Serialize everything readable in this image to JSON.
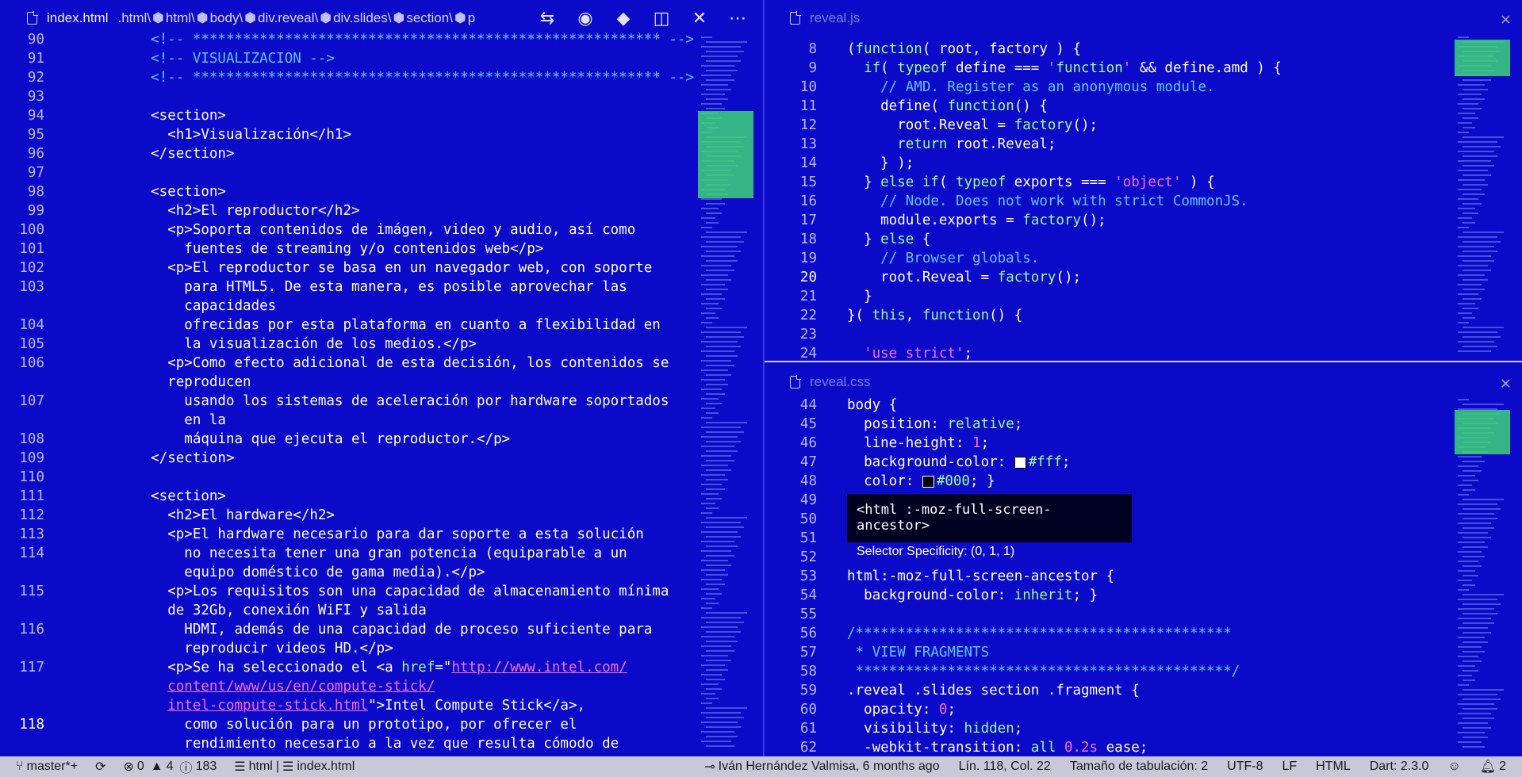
{
  "left_pane": {
    "tab_title": "index.html",
    "breadcrumbs": [
      ".html\\",
      "html\\",
      "body\\",
      "div.reveal\\",
      "div.slides\\",
      "section\\",
      "p"
    ],
    "actions": [
      "compare-changes-icon",
      "preview-icon",
      "git-icon",
      "split-editor-icon",
      "close-icon",
      "more-icon"
    ],
    "lines": [
      {
        "n": "90",
        "text": "    <!-- ******************************************************** -->"
      },
      {
        "n": "91",
        "text": "    <!-- VISUALIZACION -->"
      },
      {
        "n": "92",
        "text": "    <!-- ******************************************************** -->"
      },
      {
        "n": "93",
        "text": ""
      },
      {
        "n": "94",
        "text": "    <section>"
      },
      {
        "n": "95",
        "text": "      <h1>Visualización</h1>"
      },
      {
        "n": "96",
        "text": "    </section>"
      },
      {
        "n": "97",
        "text": ""
      },
      {
        "n": "98",
        "text": "    <section>"
      },
      {
        "n": "99",
        "text": "      <h2>El reproductor</h2>"
      },
      {
        "n": "100",
        "text": "      <p>Soporta contenidos de imágen, video y audio, así como"
      },
      {
        "n": "101",
        "text": "        fuentes de streaming y/o contenidos web</p>"
      },
      {
        "n": "102",
        "text": "      <p>El reproductor se basa en un navegador web, con soporte"
      },
      {
        "n": "103",
        "text": "        para HTML5. De esta manera, es posible aprovechar las"
      },
      {
        "n": "",
        "text": "        capacidades"
      },
      {
        "n": "104",
        "text": "        ofrecidas por esta plataforma en cuanto a flexibilidad en"
      },
      {
        "n": "105",
        "text": "        la visualización de los medios.</p>"
      },
      {
        "n": "106",
        "text": "      <p>Como efecto adicional de esta decisión, los contenidos se"
      },
      {
        "n": "",
        "text": "      reproducen"
      },
      {
        "n": "107",
        "text": "        usando los sistemas de aceleración por hardware soportados"
      },
      {
        "n": "",
        "text": "        en la"
      },
      {
        "n": "108",
        "text": "        máquina que ejecuta el reproductor.</p>"
      },
      {
        "n": "109",
        "text": "    </section>"
      },
      {
        "n": "110",
        "text": ""
      },
      {
        "n": "111",
        "text": "    <section>"
      },
      {
        "n": "112",
        "text": "      <h2>El hardware</h2>"
      },
      {
        "n": "113",
        "text": "      <p>El hardware necesario para dar soporte a esta solución"
      },
      {
        "n": "114",
        "text": "        no necesita tener una gran potencia (equiparable a un"
      },
      {
        "n": "",
        "text": "        equipo doméstico de gama media).</p>"
      },
      {
        "n": "115",
        "text": "      <p>Los requisitos son una capacidad de almacenamiento mínima"
      },
      {
        "n": "",
        "text": "      de 32Gb, conexión WiFI y salida"
      },
      {
        "n": "116",
        "text": "        HDMI, además de una capacidad de proceso suficiente para"
      },
      {
        "n": "",
        "text": "        reproducir videos HD.</p>"
      },
      {
        "n": "117",
        "text": "      <p>Se ha seleccionado el <a href=\"http://www.intel.com/"
      },
      {
        "n": "",
        "text": "      content/www/us/en/compute-stick/"
      },
      {
        "n": "",
        "text": "      intel-compute-stick.html\">Intel Compute Stick</a>,"
      },
      {
        "n": "118",
        "text": "        como solución para un prototipo, por ofrecer el"
      },
      {
        "n": "",
        "text": "        rendimiento necesario a la vez que resulta cómodo de"
      }
    ]
  },
  "right_top_pane": {
    "tab_title": "reveal.js",
    "lines": [
      {
        "n": "8",
        "text": "(function( root, factory ) {"
      },
      {
        "n": "9",
        "text": "  if( typeof define === 'function' && define.amd ) {"
      },
      {
        "n": "10",
        "text": "    // AMD. Register as an anonymous module."
      },
      {
        "n": "11",
        "text": "    define( function() {"
      },
      {
        "n": "12",
        "text": "      root.Reveal = factory();"
      },
      {
        "n": "13",
        "text": "      return root.Reveal;"
      },
      {
        "n": "14",
        "text": "    } );"
      },
      {
        "n": "15",
        "text": "  } else if( typeof exports === 'object' ) {"
      },
      {
        "n": "16",
        "text": "    // Node. Does not work with strict CommonJS."
      },
      {
        "n": "17",
        "text": "    module.exports = factory();"
      },
      {
        "n": "18",
        "text": "  } else {"
      },
      {
        "n": "19",
        "text": "    // Browser globals."
      },
      {
        "n": "20",
        "text": "    root.Reveal = factory();"
      },
      {
        "n": "21",
        "text": "  }"
      },
      {
        "n": "22",
        "text": "}( this, function() {"
      },
      {
        "n": "23",
        "text": ""
      },
      {
        "n": "24",
        "text": "  'use strict';"
      }
    ]
  },
  "right_bottom_pane": {
    "tab_title": "reveal.css",
    "lines": [
      {
        "n": "44",
        "text": "body {"
      },
      {
        "n": "45",
        "text": "  position: relative;"
      },
      {
        "n": "46",
        "text": "  line-height: 1;"
      },
      {
        "n": "47",
        "text": "  background-color: #fff;"
      },
      {
        "n": "48",
        "text": "  color: #000; }"
      },
      {
        "n": "49",
        "text": ""
      },
      {
        "n": "50",
        "text": ""
      },
      {
        "n": "51",
        "text": ""
      },
      {
        "n": "52",
        "text": ""
      },
      {
        "n": "53",
        "text": "html:-moz-full-screen-ancestor {"
      },
      {
        "n": "54",
        "text": "  background-color: inherit; }"
      },
      {
        "n": "55",
        "text": ""
      },
      {
        "n": "56",
        "text": "/*********************************************"
      },
      {
        "n": "57",
        "text": " * VIEW FRAGMENTS"
      },
      {
        "n": "58",
        "text": " *********************************************/"
      },
      {
        "n": "59",
        "text": ".reveal .slides section .fragment {"
      },
      {
        "n": "60",
        "text": "  opacity: 0;"
      },
      {
        "n": "61",
        "text": "  visibility: hidden;"
      },
      {
        "n": "62",
        "text": "  -webkit-transition: all 0.2s ease;"
      }
    ],
    "hover": {
      "selector": "<html :-moz-full-screen-ancestor>",
      "specificity": "Selector Specificity: (0, 1, 1)"
    }
  },
  "status_bar": {
    "branch": "master*+",
    "errors": "0",
    "warnings": "4",
    "info": "183",
    "language_mode": "html",
    "file": "index.html",
    "blame": "Iván Hernández Valmisa, 6 months ago",
    "position": "Lín. 118, Col. 22",
    "tab_size": "Tamaño de tabulación: 2",
    "encoding": "UTF-8",
    "eol": "LF",
    "language": "HTML",
    "dart": "Dart: 2.3.0",
    "notifications": "2"
  },
  "colors": {
    "background": "#0a0ac8",
    "keyword": "#98ff98",
    "string": "#ff6be3",
    "comment": "#60c6ff",
    "statusbar": "#c8c8d8"
  }
}
